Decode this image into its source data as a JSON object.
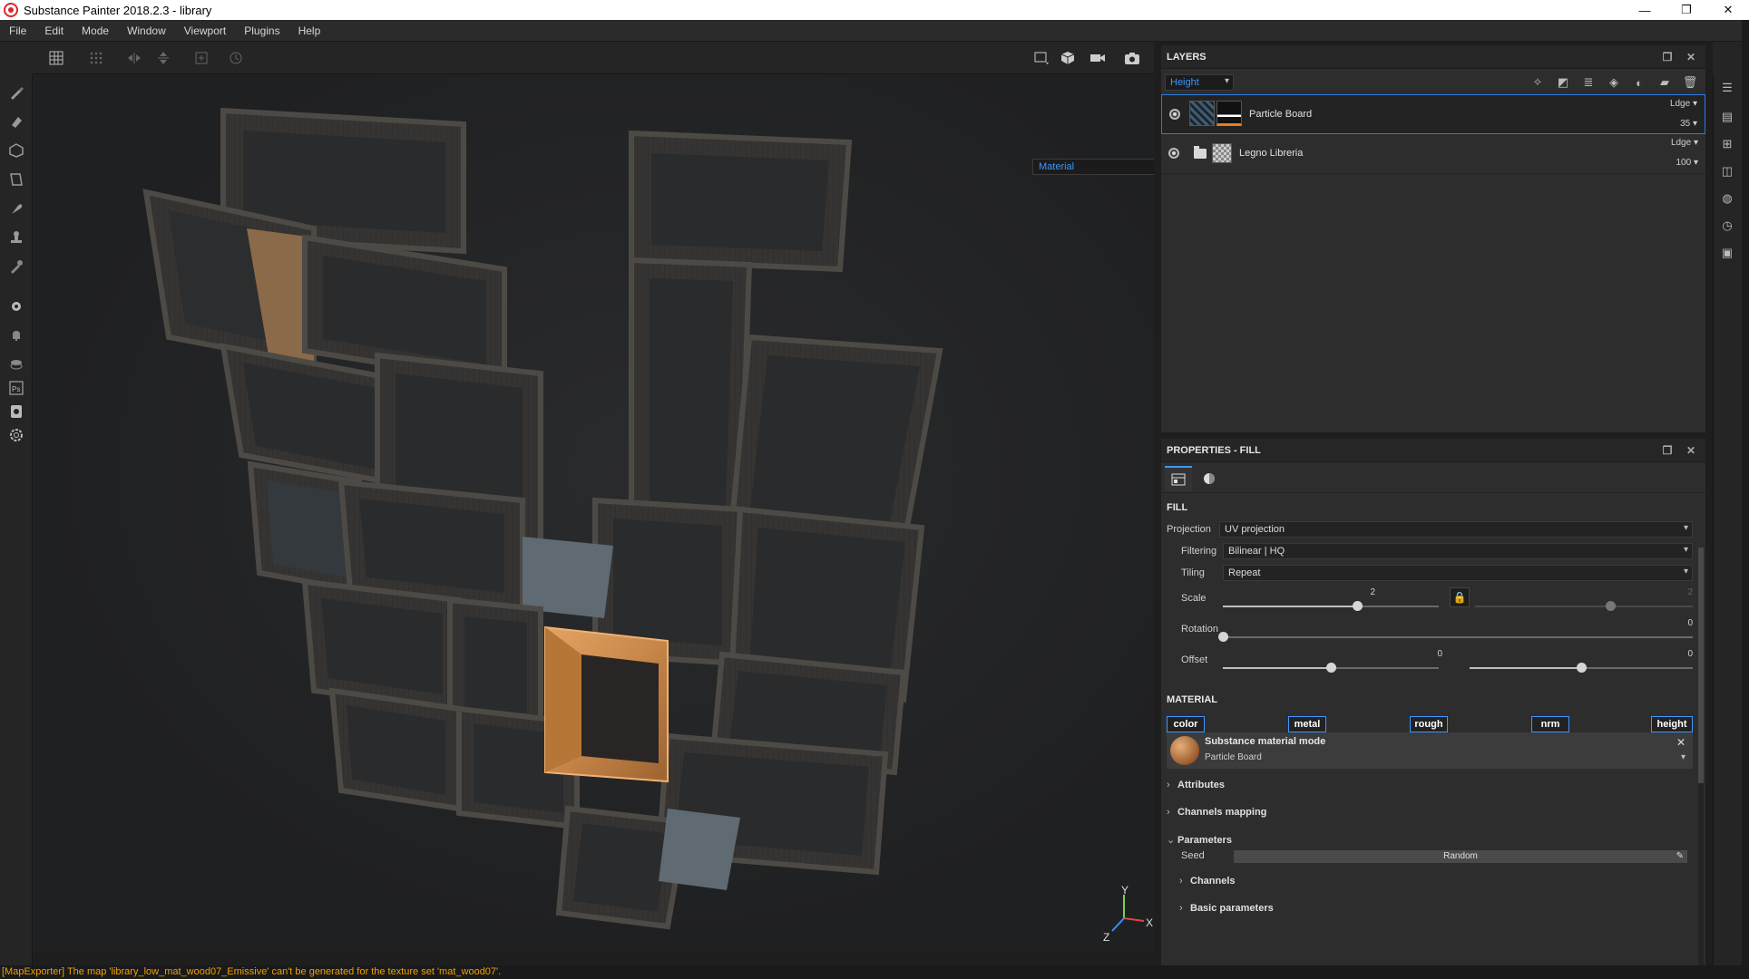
{
  "window": {
    "title": "Substance Painter 2018.2.3 - library",
    "controls": [
      "—",
      "❐",
      "✕"
    ]
  },
  "menu": [
    "File",
    "Edit",
    "Mode",
    "Window",
    "Viewport",
    "Plugins",
    "Help"
  ],
  "viewport": {
    "display_mode": "Material",
    "axis_labels": {
      "x": "X",
      "y": "Y",
      "z": "Z"
    }
  },
  "layers": {
    "title": "LAYERS",
    "channel": "Height",
    "items": [
      {
        "name": "Particle Board",
        "blend": "Ldge",
        "opacity": "35",
        "selected": true
      },
      {
        "name": "Legno Libreria",
        "blend": "Ldge",
        "opacity": "100",
        "selected": false
      }
    ]
  },
  "properties": {
    "title": "PROPERTIES - FILL",
    "fill_section": "FILL",
    "projection": {
      "label": "Projection",
      "value": "UV projection"
    },
    "filtering": {
      "label": "Filtering",
      "value": "Bilinear | HQ"
    },
    "tiling": {
      "label": "Tiling",
      "value": "Repeat"
    },
    "scale": {
      "label": "Scale",
      "value_a": "2",
      "value_b": "2",
      "fraction_a": 0.62,
      "fraction_b": 0.62
    },
    "rotation": {
      "label": "Rotation",
      "value": "0",
      "fraction": 0.0
    },
    "offset": {
      "label": "Offset",
      "value_a": "0",
      "value_b": "0",
      "fraction_a": 0.5,
      "fraction_b": 0.5
    },
    "material_section": "MATERIAL",
    "channels": [
      "color",
      "metal",
      "rough",
      "nrm",
      "height"
    ],
    "substance": {
      "mode_title": "Substance material mode",
      "name": "Particle Board"
    },
    "attributes": "Attributes",
    "channels_mapping": "Channels mapping",
    "parameters": "Parameters",
    "seed": {
      "label": "Seed",
      "value": "Random"
    },
    "channels_group": "Channels",
    "basic_parameters": "Basic parameters"
  },
  "status": {
    "message": "[MapExporter] The map 'library_low_mat_wood07_Emissive' can't be generated for the texture set 'mat_wood07'."
  },
  "colors": {
    "accent": "#3c96ff",
    "status_warning": "#f0a000",
    "selection_border": "#2c7be5",
    "particle_board": "#c8874a"
  }
}
